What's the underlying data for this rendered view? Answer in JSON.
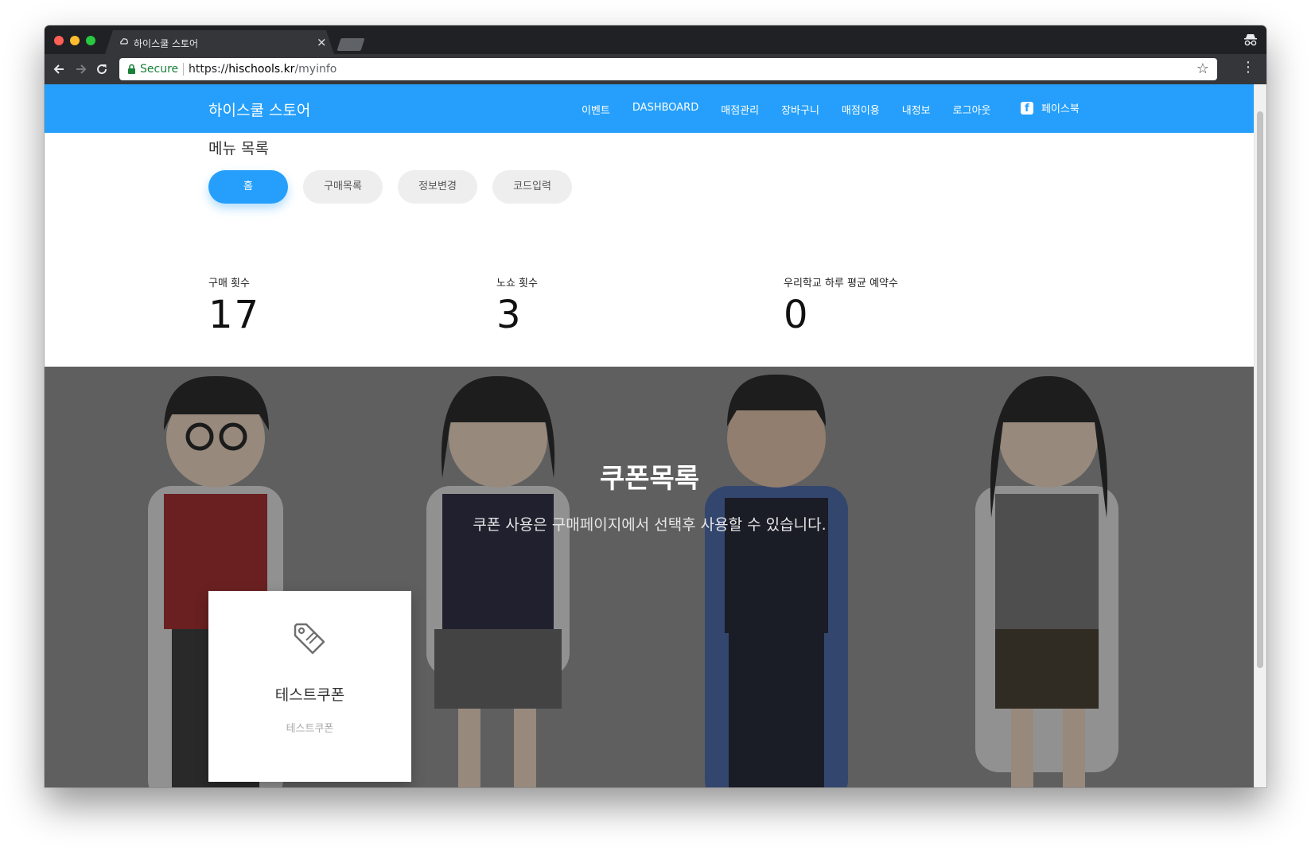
{
  "browser": {
    "tab_title": "하이스쿨 스토어",
    "tab_close": "×",
    "secure_label": "Secure",
    "url_scheme": "https://",
    "url_host": "hischools.kr",
    "url_path": "/myinfo",
    "star": "☆",
    "menu": "⋮"
  },
  "nav": {
    "brand": "하이스쿨 스토어",
    "links": [
      "이벤트",
      "DASHBOARD",
      "매점관리",
      "장바구니",
      "매점이용",
      "내정보",
      "로그아웃"
    ],
    "facebook": "페이스북",
    "facebook_icon_glyph": "f"
  },
  "menu": {
    "title": "메뉴 목록",
    "pills": [
      "홈",
      "구매목록",
      "정보변경",
      "코드입력"
    ],
    "active_index": 0
  },
  "stats": [
    {
      "label": "구매 횟수",
      "value": "17"
    },
    {
      "label": "노쇼 횟수",
      "value": "3"
    },
    {
      "label": "우리학교 하루 평균 예약수",
      "value": "0"
    }
  ],
  "coupons": {
    "title": "쿠폰목록",
    "subtitle": "쿠폰 사용은 구매페이지에서 선택후 사용할 수 있습니다.",
    "items": [
      {
        "name": "테스트쿠폰",
        "description": "테스트쿠폰",
        "icon": "tag-icon"
      }
    ]
  },
  "colors": {
    "primary": "#259ffb",
    "browser_frame": "#202124",
    "browser_toolbar": "#35363a"
  }
}
